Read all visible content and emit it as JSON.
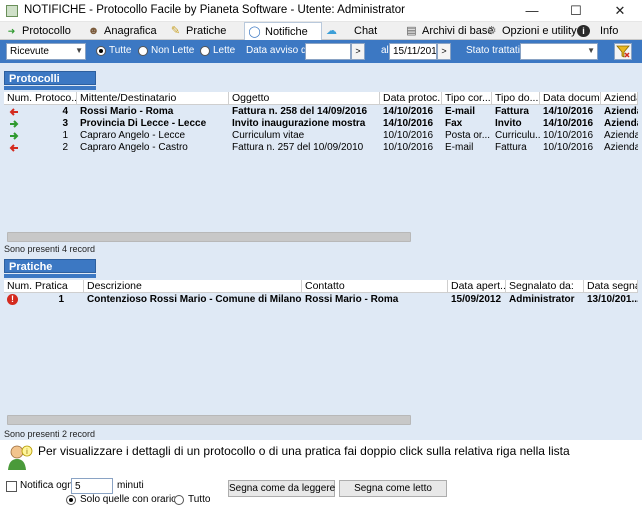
{
  "window": {
    "title": "NOTIFICHE - Protocollo Facile by Pianeta Software - Utente: Administrator"
  },
  "tabs": [
    {
      "label": "Protocollo"
    },
    {
      "label": "Anagrafica"
    },
    {
      "label": "Pratiche"
    },
    {
      "label": "Notifiche"
    },
    {
      "label": "Chat"
    },
    {
      "label": "Archivi di base"
    },
    {
      "label": "Opzioni e utility"
    },
    {
      "label": "Info"
    }
  ],
  "filters": {
    "type_value": "Ricevute",
    "radio_all": "Tutte",
    "radio_unread": "Non Lette",
    "radio_read": "Lette",
    "date_from_label": "Data avviso dal:",
    "date_from_value": "",
    "date_to_label": "al:",
    "date_to_value": "15/11/2016",
    "status_label": "Stato trattativa:",
    "status_value": "",
    "selected_radio": "Tutte"
  },
  "protocolli": {
    "title": "Protocolli",
    "columns": [
      "Num. Protoco...",
      "Mittente/Destinatario",
      "Oggetto",
      "Data protoc...",
      "Tipo cor...",
      "Tipo do...",
      "Data docum...",
      "Azienda"
    ],
    "rows": [
      {
        "direction": "in",
        "bold": true,
        "cells": [
          "4",
          "Rossi Mario - Roma",
          "Fattura n. 258 del 14/09/2016",
          "14/10/2016",
          "E-mail",
          "Fattura",
          "14/10/2016",
          "Azienda"
        ]
      },
      {
        "direction": "out",
        "bold": true,
        "cells": [
          "3",
          "Provincia Di Lecce - Lecce",
          "Invito inaugurazione mostra",
          "14/10/2016",
          "Fax",
          "Invito",
          "14/10/2016",
          "Azienda"
        ]
      },
      {
        "direction": "out",
        "bold": false,
        "cells": [
          "1",
          "Capraro Angelo - Lecce",
          "Curriculum vitae",
          "10/10/2016",
          "Posta or...",
          "Curriculu...",
          "10/10/2016",
          "Azienda"
        ]
      },
      {
        "direction": "in",
        "bold": false,
        "cells": [
          "2",
          "Capraro Angelo - Castro",
          "Fattura n. 257 del 10/09/2010",
          "10/10/2016",
          "E-mail",
          "Fattura",
          "10/10/2016",
          "Azienda"
        ]
      }
    ],
    "count_text": "Sono presenti 4 record"
  },
  "pratiche": {
    "title": "Pratiche",
    "columns": [
      "Num. Pratica",
      "Descrizione",
      "Contatto",
      "Data apert...",
      "Segnalato da:",
      "Data segna..."
    ],
    "rows": [
      {
        "bold": true,
        "cells": [
          "1",
          "Contenzioso Rossi Mario - Comune di Milano",
          "Rossi Mario - Roma",
          "15/09/2012",
          "Administrator",
          "13/10/201..."
        ]
      }
    ],
    "count_text": "Sono presenti 2 record"
  },
  "hint": "Per visualizzare i dettagli di un protocollo o di una pratica fai doppio click sulla relativa riga nella lista",
  "bottom": {
    "notify_label": "Notifica ogni",
    "notify_value": "5",
    "minutes_label": "minuti",
    "radio_timed": "Solo quelle con orario",
    "radio_all": "Tutto",
    "mark_unread": "Segna come da leggere",
    "mark_read": "Segna come letto"
  },
  "colors": {
    "accent": "#3c78c3",
    "panel": "#dfe9f5",
    "arrow_in": "#d42a1e",
    "arrow_out": "#2f9a2f"
  },
  "icons": {
    "protocollo": "arrows-icon",
    "anagrafica": "people-icon",
    "pratiche": "pencil-icon",
    "notifiche": "bubble-icon",
    "chat": "chat-icon",
    "archivi": "book-icon",
    "opzioni": "gear-icon",
    "info": "info-icon"
  }
}
